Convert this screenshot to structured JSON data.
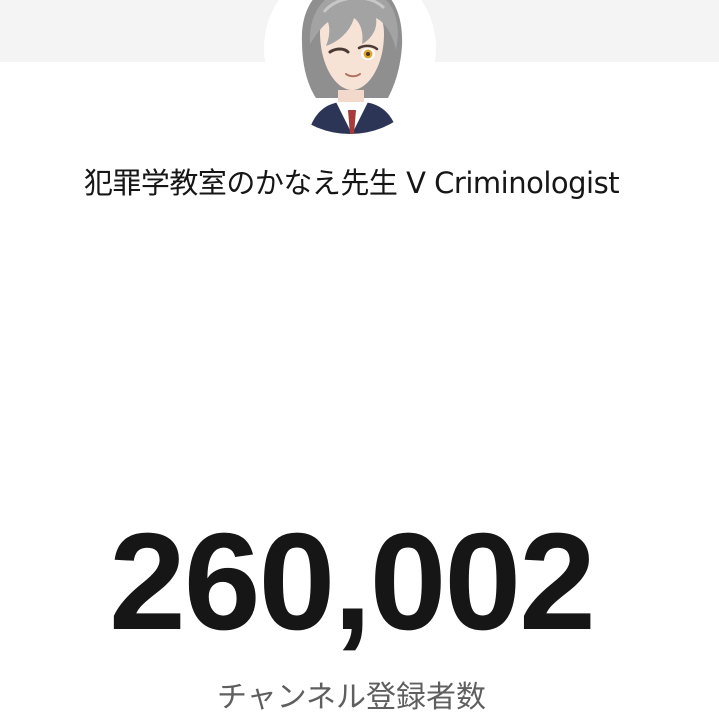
{
  "channel": {
    "name": "犯罪学教室のかなえ先生 V Criminologist",
    "subscriber_count": "260,002",
    "subscriber_label": "チャンネル登録者数"
  },
  "colors": {
    "top_band": "#f4f4f4",
    "count_text": "#161616",
    "label_text": "#5f5f5f"
  },
  "icons": {
    "avatar": "channel-avatar-illustration"
  }
}
